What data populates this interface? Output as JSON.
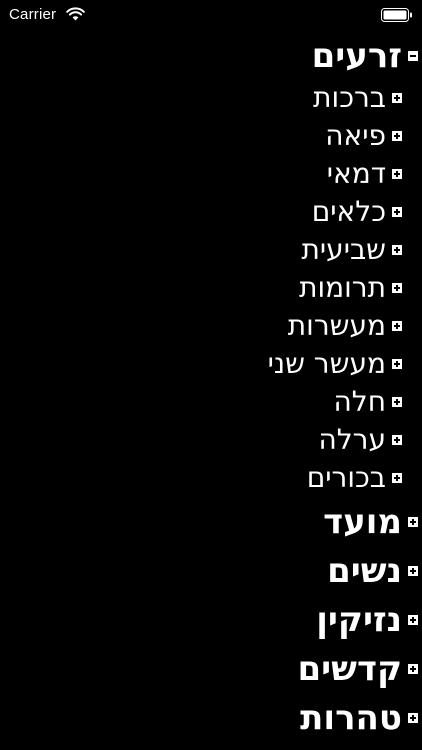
{
  "status_bar": {
    "carrier": "Carrier",
    "wifi_icon": "wifi-icon",
    "battery_icon": "battery-icon"
  },
  "tree": {
    "orders": [
      {
        "label": "זרעים",
        "expanded": true,
        "tractates": [
          {
            "label": "ברכות"
          },
          {
            "label": "פיאה"
          },
          {
            "label": "דמאי"
          },
          {
            "label": "כלאים"
          },
          {
            "label": "שביעית"
          },
          {
            "label": "תרומות"
          },
          {
            "label": "מעשרות"
          },
          {
            "label": "מעשר שני"
          },
          {
            "label": "חלה"
          },
          {
            "label": "ערלה"
          },
          {
            "label": "בכורים"
          }
        ]
      },
      {
        "label": "מועד",
        "expanded": false
      },
      {
        "label": "נשים",
        "expanded": false
      },
      {
        "label": "נזיקין",
        "expanded": false
      },
      {
        "label": "קדשים",
        "expanded": false
      },
      {
        "label": "טהרות",
        "expanded": false
      }
    ]
  },
  "colors": {
    "background": "#000000",
    "text": "#ffffff"
  }
}
